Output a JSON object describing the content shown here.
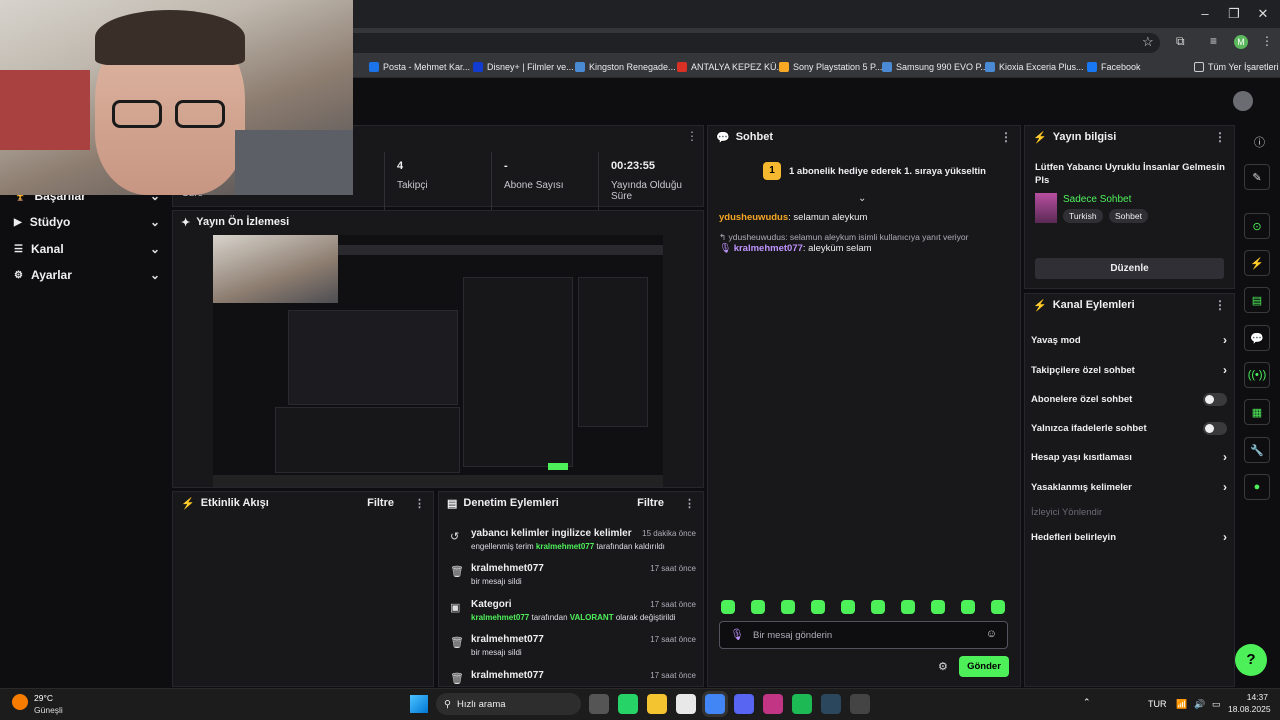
{
  "browser": {
    "bookmarks": [
      {
        "label": "Posta - Mehmet Kar...",
        "color": "#1a73e8"
      },
      {
        "label": "Disney+ | Filmler ve...",
        "color": "#113ccf"
      },
      {
        "label": "Kingston Renegade...",
        "color": "#4a8ad4"
      },
      {
        "label": "ANTALYA KEPEZ KÜ...",
        "color": "#d93025"
      },
      {
        "label": "Sony Playstation 5 P...",
        "color": "#f9a825"
      },
      {
        "label": "Samsung 990 EVO P...",
        "color": "#4a8ad4"
      },
      {
        "label": "Kioxia Exceria Plus...",
        "color": "#4a8ad4"
      },
      {
        "label": "Facebook",
        "color": "#1877f2"
      }
    ],
    "all_bookmarks": "Tüm Yer İşaretleri",
    "profile_initial": "M"
  },
  "nav": {
    "items": [
      {
        "label": "Başarılar",
        "icon": "trophy-icon"
      },
      {
        "label": "Stüdyo",
        "icon": "studio-icon"
      },
      {
        "label": "Kanal",
        "icon": "channel-icon"
      },
      {
        "label": "Ayarlar",
        "icon": "gear-icon"
      }
    ]
  },
  "stats": {
    "cutoff_label": "Süre",
    "items": [
      {
        "value": "4",
        "label": "Takipçi"
      },
      {
        "value": "-",
        "label": "Abone Sayısı"
      },
      {
        "value": "00:23:55",
        "label": "Yayında Olduğu Süre"
      }
    ]
  },
  "preview": {
    "title": "Yayın Ön İzlemesi"
  },
  "activity": {
    "title": "Etkinlik Akışı",
    "filter": "Filtre"
  },
  "modlog": {
    "title": "Denetim Eylemleri",
    "filter": "Filtre",
    "entries": [
      {
        "icon": "undo-icon",
        "title": "yabancı kelimler ingilizce kelimler",
        "time": "15 dakika önce",
        "desc_pre": "engellenmiş terim ",
        "user": "kralmehmet077",
        "desc_post": " tarafından kaldırıldı"
      },
      {
        "icon": "trash-icon",
        "title": "kralmehmet077",
        "time": "17 saat önce",
        "desc_pre": "bir mesajı sildi",
        "user": "",
        "desc_post": ""
      },
      {
        "icon": "category-icon",
        "title": "Kategori",
        "time": "17 saat önce",
        "desc_pre": "",
        "user": "kralmehmet077",
        "desc_post": " tarafından ",
        "extra": "VALORANT",
        "desc_tail": " olarak değiştirildi"
      },
      {
        "icon": "trash-icon",
        "title": "kralmehmet077",
        "time": "17 saat önce",
        "desc_pre": "bir mesajı sildi",
        "user": "",
        "desc_post": ""
      },
      {
        "icon": "trash-icon",
        "title": "kralmehmet077",
        "time": "17 saat önce",
        "desc_pre": "",
        "user": "",
        "desc_post": ""
      }
    ]
  },
  "chat": {
    "title": "Sohbet",
    "gift_banner": "1 abonelik hediye ederek 1. sıraya yükseltin",
    "gift_rank": "1",
    "messages": [
      {
        "user": "ydusheuwudus",
        "text": ": selamun aleykum",
        "color": "#f5a623"
      }
    ],
    "reply_context": "ydusheuwudus: selamun aleykum isimli kullanıcıya yanıt veriyor",
    "reply": {
      "user": "kralmehmet077",
      "text": ": aleyküm selam",
      "color": "#bf94ff"
    },
    "input_placeholder": "Bir mesaj gönderin",
    "send_label": "Gönder"
  },
  "stream_info": {
    "title": "Yayın bilgisi",
    "stream_title": "Lütfen Yabancı Uyruklu İnsanlar Gelmesin Pls",
    "category": "Sadece Sohbet",
    "tags": [
      "Turkish",
      "Sohbet"
    ],
    "edit_label": "Düzenle"
  },
  "channel_actions": {
    "title": "Kanal Eylemleri",
    "items": [
      {
        "label": "Yavaş mod",
        "kind": "arrow"
      },
      {
        "label": "Takipçilere özel sohbet",
        "kind": "arrow"
      },
      {
        "label": "Abonelere özel sohbet",
        "kind": "toggle"
      },
      {
        "label": "Yalnızca ifadelerle sohbet",
        "kind": "toggle"
      },
      {
        "label": "Hesap yaşı kısıtlaması",
        "kind": "arrow"
      },
      {
        "label": "Yasaklanmış kelimeler",
        "kind": "arrow"
      },
      {
        "label": "İzleyici Yönlendir",
        "kind": "disabled"
      },
      {
        "label": "Hedefleri belirleyin",
        "kind": "arrow"
      }
    ]
  },
  "taskbar": {
    "weather_temp": "29°C",
    "weather_desc": "Güneşli",
    "search": "Hızlı arama",
    "lang": "TUR",
    "time": "14:37",
    "date": "18.08.2025"
  },
  "colors": {
    "accent": "#4ef05a",
    "panel": "#18181b",
    "bg": "#0e0e10"
  }
}
